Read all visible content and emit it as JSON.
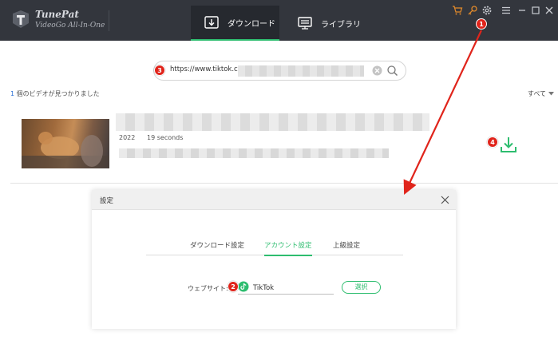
{
  "app": {
    "name": "TunePat",
    "subtitle": "VideoGo All-In-One"
  },
  "tabs": [
    {
      "label": "ダウンロード",
      "active": true
    },
    {
      "label": "ライブラリ",
      "active": false
    }
  ],
  "toolbar_icons": [
    "cart-icon",
    "key-icon",
    "gear-icon",
    "menu-icon",
    "minimize-icon",
    "maximize-icon",
    "close-icon"
  ],
  "search": {
    "value": "https://www.tiktok.com/"
  },
  "results": {
    "count": "1",
    "count_label": " 個のビデオが見つかりました",
    "filter_label": "すべて"
  },
  "video": {
    "year": "2022",
    "duration": "19 seconds"
  },
  "settings_dialog": {
    "title": "設定",
    "tabs": [
      {
        "label": "ダウンロード設定",
        "active": false
      },
      {
        "label": "アカウント設定",
        "active": true
      },
      {
        "label": "上級設定",
        "active": false
      }
    ],
    "website_label": "ウェブサイト:",
    "website_value": "TikTok",
    "select_button": "選択"
  },
  "annotations": [
    "1",
    "2",
    "3",
    "4"
  ],
  "colors": {
    "titlebar": "#33363d",
    "accent_green": "#2ebd6f",
    "annotation_red": "#e0241b",
    "toolbar_orange": "#e0892b",
    "link_blue": "#2f73d8"
  }
}
